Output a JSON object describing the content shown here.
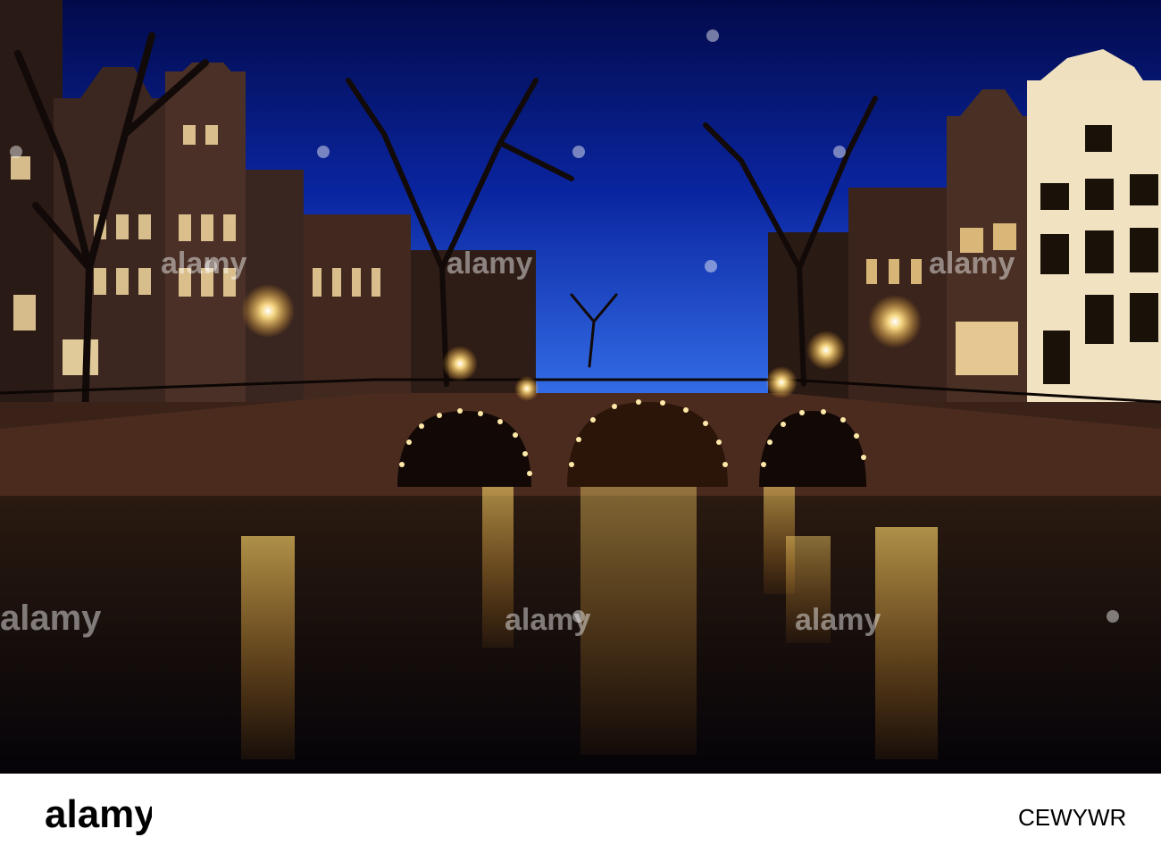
{
  "photo": {
    "subject": "Amsterdam canal bridge at night",
    "colors": {
      "sky_top": "#03105a",
      "sky_bottom": "#1d4fd6",
      "lamp_glow": "#ffd66b",
      "water": "#1a0f0a",
      "brick": "#4a2b20"
    }
  },
  "watermark": {
    "text": "alamy",
    "icon": "alamy-lens-icon"
  },
  "footer": {
    "brand": "alamy",
    "image_id": "CEWYWR",
    "background": "#ffffff",
    "text_color": "#000000"
  }
}
